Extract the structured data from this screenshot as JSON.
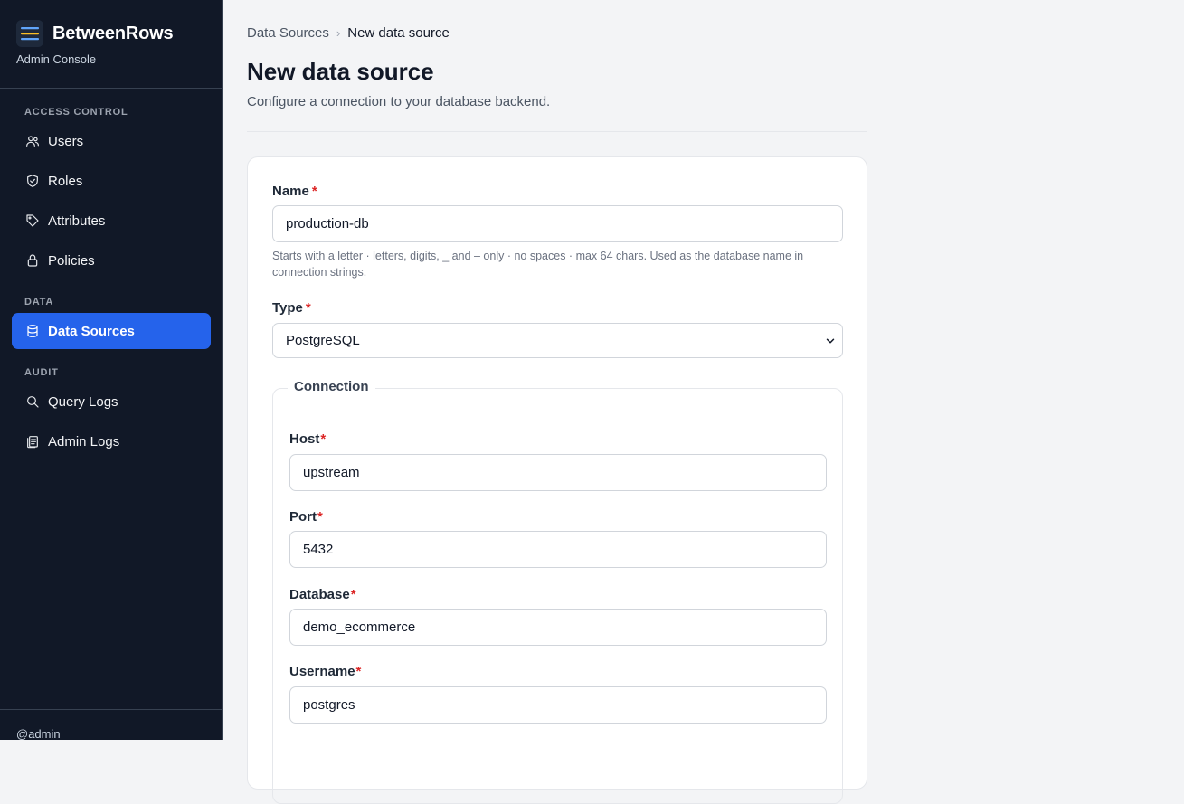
{
  "sidebar": {
    "brand_name": "BetweenRows",
    "brand_subtitle": "Admin Console",
    "sections": [
      {
        "label": "ACCESS CONTROL"
      },
      {
        "label": "DATA"
      },
      {
        "label": "AUDIT"
      }
    ],
    "items": [
      {
        "label": "Users",
        "icon": "users-icon"
      },
      {
        "label": "Roles",
        "icon": "shield-icon"
      },
      {
        "label": "Attributes",
        "icon": "tag-icon"
      },
      {
        "label": "Policies",
        "icon": "lock-icon"
      },
      {
        "label": "Data Sources",
        "icon": "database-icon",
        "active": true
      },
      {
        "label": "Query Logs",
        "icon": "search-icon"
      },
      {
        "label": "Admin Logs",
        "icon": "clipboard-icon"
      }
    ],
    "user_handle": "@admin"
  },
  "breadcrumb": {
    "parent": "Data Sources",
    "current": "New data source"
  },
  "page": {
    "title": "New data source",
    "subtitle": "Configure a connection to your database backend."
  },
  "form": {
    "name": {
      "label": "Name",
      "value": "production-db",
      "help": "Starts with a letter · letters, digits, _ and – only · no spaces · max 64 chars. Used as the database name in connection strings."
    },
    "type": {
      "label": "Type",
      "value": "PostgreSQL"
    },
    "connection": {
      "legend": "Connection",
      "host": {
        "label": "Host",
        "value": "upstream"
      },
      "port": {
        "label": "Port",
        "value": "5432"
      },
      "database": {
        "label": "Database",
        "value": "demo_ecommerce"
      },
      "username": {
        "label": "Username",
        "value": "postgres"
      }
    },
    "required_marker": "*"
  },
  "colors": {
    "sidebar_bg": "#111827",
    "accent": "#2563eb",
    "required": "#dc2626",
    "page_bg": "#f3f4f6"
  }
}
